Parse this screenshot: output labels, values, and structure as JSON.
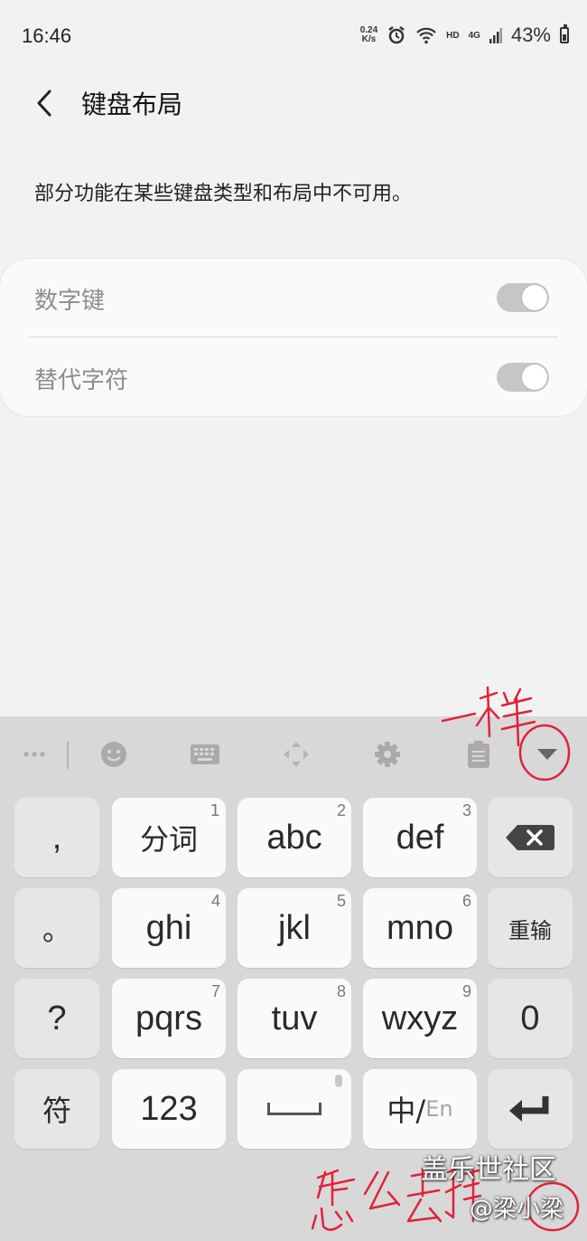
{
  "status_bar": {
    "time": "16:46",
    "net_speed_value": "0.24",
    "net_speed_unit": "K/s",
    "network_label": "HD",
    "network_type": "4G",
    "battery": "43%"
  },
  "header": {
    "title": "键盘布局"
  },
  "description": "部分功能在某些键盘类型和布局中不可用。",
  "settings": {
    "items": [
      {
        "label": "数字键",
        "enabled": true
      },
      {
        "label": "替代字符",
        "enabled": true
      }
    ]
  },
  "keyboard": {
    "toolbar_icons": [
      "more-icon",
      "emoji-icon",
      "keyboard-icon",
      "move-icon",
      "gear-icon",
      "clipboard-icon",
      "chevron-down-icon"
    ],
    "row1": {
      "side_left": ",",
      "keys": [
        {
          "label": "分词",
          "num": "1"
        },
        {
          "label": "abc",
          "num": "2"
        },
        {
          "label": "def",
          "num": "3"
        }
      ]
    },
    "row2": {
      "side_left": "。",
      "keys": [
        {
          "label": "ghi",
          "num": "4"
        },
        {
          "label": "jkl",
          "num": "5"
        },
        {
          "label": "mno",
          "num": "6"
        }
      ],
      "side_right": "重输"
    },
    "row3": {
      "side_left": "?",
      "keys": [
        {
          "label": "pqrs",
          "num": "7"
        },
        {
          "label": "tuv",
          "num": "8"
        },
        {
          "label": "wxyz",
          "num": "9"
        }
      ],
      "side_right": "0"
    },
    "row4": {
      "side_left": "符",
      "num_key": "123",
      "lang_main": "中/",
      "lang_alt": "En"
    }
  },
  "annotations": {
    "note_top": "一样",
    "note_bottom": "怎么去掉"
  },
  "watermark": {
    "site": "盖乐世社区",
    "user": "@梁小梁"
  }
}
